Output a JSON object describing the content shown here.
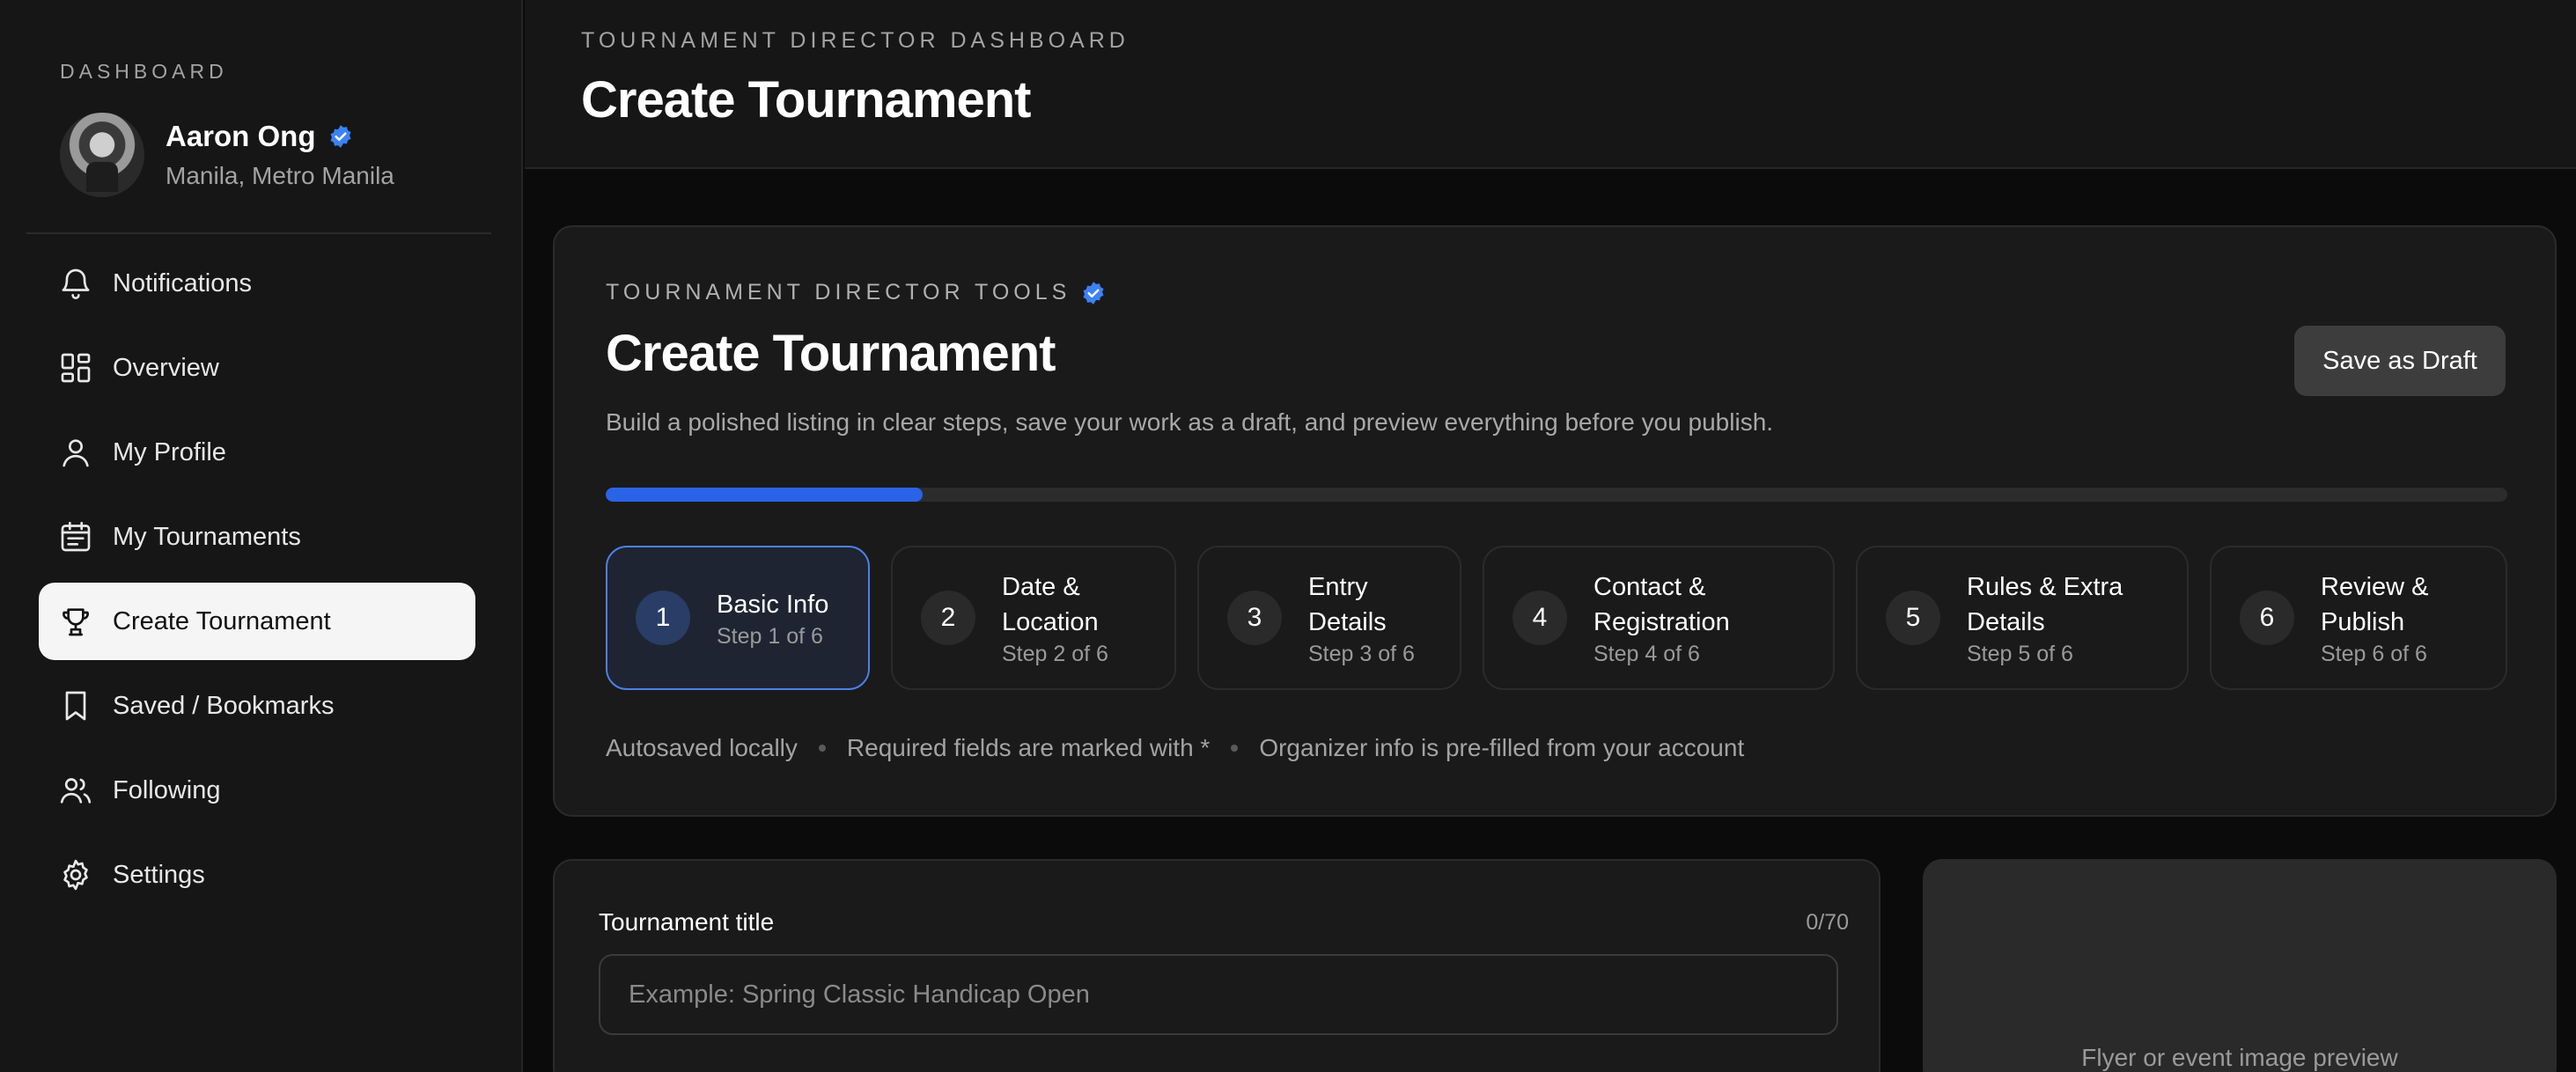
{
  "sidebar": {
    "section_label": "DASHBOARD",
    "user": {
      "name": "Aaron Ong",
      "location": "Manila, Metro Manila"
    },
    "items": [
      {
        "label": "Notifications",
        "icon": "bell-icon"
      },
      {
        "label": "Overview",
        "icon": "dashboard-grid-icon"
      },
      {
        "label": "My Profile",
        "icon": "user-icon"
      },
      {
        "label": "My Tournaments",
        "icon": "calendar-list-icon"
      },
      {
        "label": "Create Tournament",
        "icon": "trophy-icon",
        "active": true
      },
      {
        "label": "Saved / Bookmarks",
        "icon": "bookmark-icon"
      },
      {
        "label": "Following",
        "icon": "users-icon"
      },
      {
        "label": "Settings",
        "icon": "gear-icon"
      }
    ]
  },
  "header": {
    "eyebrow": "TOURNAMENT DIRECTOR DASHBOARD",
    "title": "Create Tournament"
  },
  "tools": {
    "eyebrow": "TOURNAMENT DIRECTOR TOOLS",
    "title": "Create Tournament",
    "description": "Build a polished listing in clear steps, save your work as a draft, and preview everything before you publish.",
    "save_draft_label": "Save as Draft",
    "progress_fraction": 0.1667,
    "steps": [
      {
        "num": "1",
        "label": "Basic Info",
        "sub": "Step 1 of 6",
        "active": true
      },
      {
        "num": "2",
        "label": "Date & Location",
        "sub": "Step 2 of 6"
      },
      {
        "num": "3",
        "label": "Entry Details",
        "sub": "Step 3 of 6"
      },
      {
        "num": "4",
        "label": "Contact & Registration",
        "sub": "Step 4 of 6"
      },
      {
        "num": "5",
        "label": "Rules & Extra Details",
        "sub": "Step 5 of 6"
      },
      {
        "num": "6",
        "label": "Review & Publish",
        "sub": "Step 6 of 6"
      }
    ],
    "meta": [
      "Autosaved locally",
      "Required fields are marked with *",
      "Organizer info is pre-filled from your account"
    ]
  },
  "form": {
    "title_label": "Tournament title",
    "title_count": "0/70",
    "title_placeholder": "Example: Spring Classic Handicap Open",
    "title_value": ""
  },
  "preview": {
    "text": "Flyer or event image preview"
  },
  "colors": {
    "accent": "#2a63e8",
    "active_step_border": "#4d80e6",
    "verified_badge": "#3b82f6"
  }
}
